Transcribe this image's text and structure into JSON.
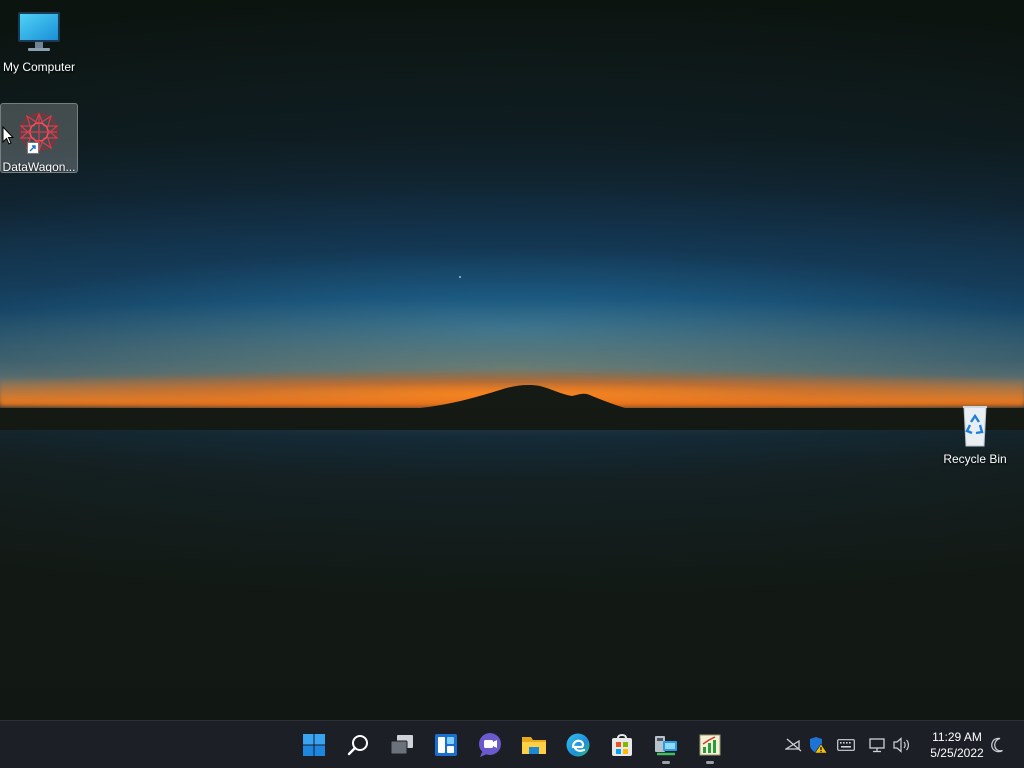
{
  "desktop": {
    "icons": [
      {
        "label": "My Computer",
        "icon": "monitor-icon"
      },
      {
        "label": "DataWagon...",
        "icon": "datawagon-app-icon",
        "shortcut": true,
        "selected": true
      },
      {
        "label": "Recycle Bin",
        "icon": "recycle-bin-icon"
      }
    ]
  },
  "taskbar": {
    "apps": [
      {
        "name": "Start",
        "icon": "windows-start-icon"
      },
      {
        "name": "Search",
        "icon": "search-icon"
      },
      {
        "name": "Task View",
        "icon": "task-view-icon"
      },
      {
        "name": "Widgets",
        "icon": "widgets-icon"
      },
      {
        "name": "Chat",
        "icon": "teams-chat-icon"
      },
      {
        "name": "File Explorer",
        "icon": "folder-icon"
      },
      {
        "name": "Microsoft Edge",
        "icon": "edge-icon"
      },
      {
        "name": "Microsoft Store",
        "icon": "store-icon"
      },
      {
        "name": "Network app",
        "icon": "network-computer-icon",
        "running": true
      },
      {
        "name": "Chart app",
        "icon": "chart-app-icon",
        "running": true
      }
    ],
    "tray": {
      "icons": [
        "network-off-icon",
        "security-warning-icon",
        "keyboard-icon",
        "display-network-icon",
        "volume-icon"
      ],
      "time": "11:29 AM",
      "date": "5/25/2022",
      "focus_icon": "moon-icon"
    }
  },
  "colors": {
    "taskbar_bg": "#1c1f26",
    "accent_blue": "#2f8fdc",
    "horizon_orange": "#ff8a1a"
  }
}
